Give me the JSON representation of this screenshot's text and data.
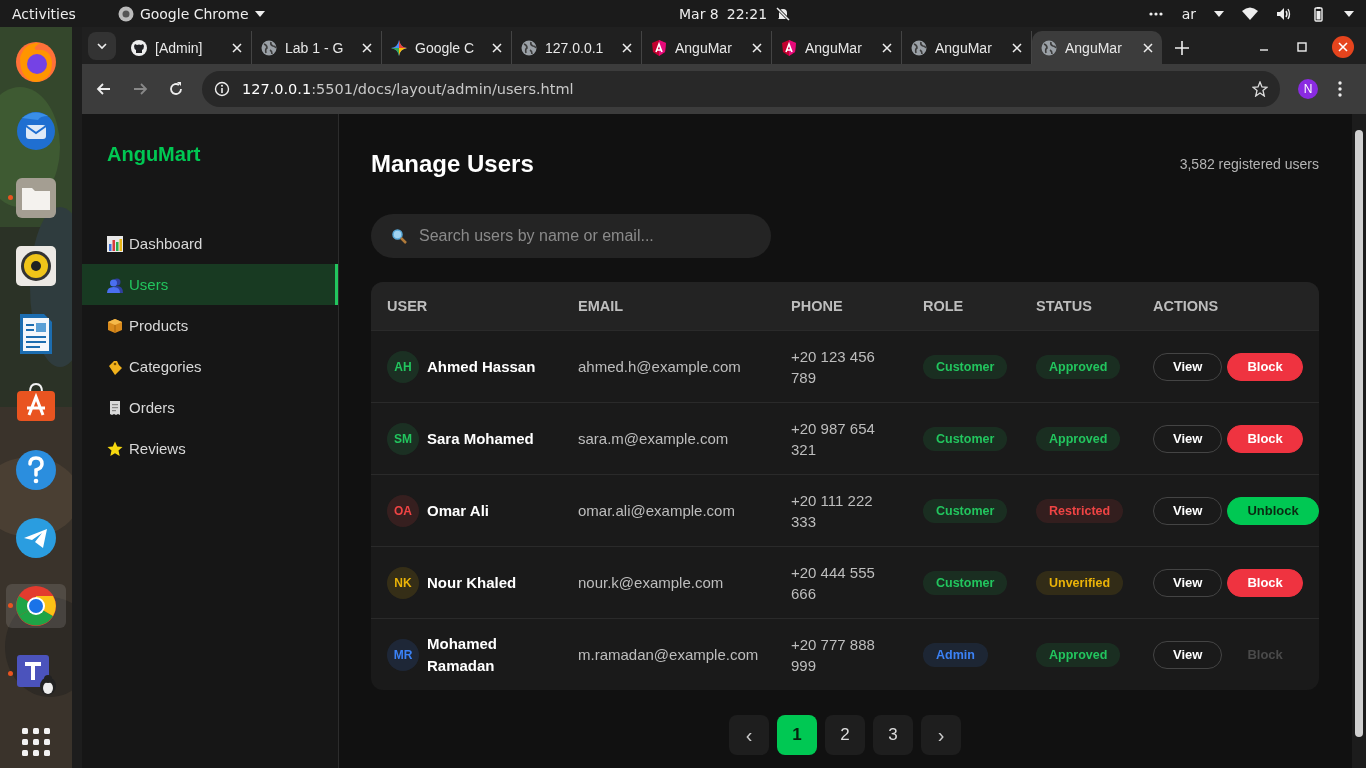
{
  "topbar": {
    "activities": "Activities",
    "app_name": "Google Chrome",
    "date": "Mar 8",
    "time": "22:21",
    "input_source": "ar"
  },
  "dock": [
    {
      "kind": "firefox",
      "running": false
    },
    {
      "kind": "thunderbird",
      "running": false
    },
    {
      "kind": "files",
      "running": true
    },
    {
      "kind": "rhythmbox",
      "running": false
    },
    {
      "kind": "writer",
      "running": false
    },
    {
      "kind": "software",
      "running": false
    },
    {
      "kind": "help",
      "running": false
    },
    {
      "kind": "telegram",
      "running": false
    },
    {
      "kind": "chrome",
      "running": true
    },
    {
      "kind": "teams",
      "running": true
    },
    {
      "kind": "apps",
      "running": false
    }
  ],
  "browser": {
    "tabs": [
      {
        "title": "[Admin]",
        "kind": "github",
        "selected": false
      },
      {
        "title": "Lab 1 - G",
        "kind": "globe",
        "selected": false
      },
      {
        "title": "Google C",
        "kind": "gemini",
        "selected": false
      },
      {
        "title": "127.0.0.1",
        "kind": "globe",
        "selected": false
      },
      {
        "title": "AnguMar",
        "kind": "angular",
        "selected": false
      },
      {
        "title": "AnguMar",
        "kind": "angular",
        "selected": false
      },
      {
        "title": "AnguMar",
        "kind": "globe",
        "selected": false
      },
      {
        "title": "AnguMar",
        "kind": "globe",
        "selected": true
      }
    ],
    "url_host": "127.0.0.1",
    "url_path": ":5501/docs/layout/admin/users.html",
    "profile": "N"
  },
  "app": {
    "brand": "AnguMart",
    "nav": [
      {
        "label": "Dashboard",
        "kind": "chart",
        "selected": false
      },
      {
        "label": "Users",
        "kind": "users",
        "selected": true
      },
      {
        "label": "Products",
        "kind": "box",
        "selected": false
      },
      {
        "label": "Categories",
        "kind": "tag",
        "selected": false
      },
      {
        "label": "Orders",
        "kind": "receipt",
        "selected": false
      },
      {
        "label": "Reviews",
        "kind": "star",
        "selected": false
      }
    ],
    "title": "Manage Users",
    "count": "3,582 registered users",
    "search": {
      "placeholder": "Search users by name or email..."
    },
    "table": {
      "columns": [
        "USER",
        "EMAIL",
        "PHONE",
        "ROLE",
        "STATUS",
        "ACTIONS"
      ],
      "rows": [
        {
          "initials": "AH",
          "name": "Ahmed Hassan",
          "email": "ahmed.h@example.com",
          "phone": "+20 123 456 789",
          "role": {
            "label": "Customer",
            "kind": "customer"
          },
          "status": {
            "label": "Approved",
            "kind": "approved"
          },
          "view": "View",
          "action": {
            "label": "Block",
            "kind": "block",
            "disabled": false
          }
        },
        {
          "initials": "SM",
          "name": "Sara Mohamed",
          "email": "sara.m@example.com",
          "phone": "+20 987 654 321",
          "role": {
            "label": "Customer",
            "kind": "customer"
          },
          "status": {
            "label": "Approved",
            "kind": "approved"
          },
          "view": "View",
          "action": {
            "label": "Block",
            "kind": "block",
            "disabled": false
          }
        },
        {
          "initials": "OA",
          "name": "Omar Ali",
          "email": "omar.ali@example.com",
          "phone": "+20 111 222 333",
          "role": {
            "label": "Customer",
            "kind": "customer"
          },
          "status": {
            "label": "Restricted",
            "kind": "restricted"
          },
          "view": "View",
          "action": {
            "label": "Unblock",
            "kind": "unblock",
            "disabled": false
          }
        },
        {
          "initials": "NK",
          "name": "Nour Khaled",
          "email": "nour.k@example.com",
          "phone": "+20 444 555 666",
          "role": {
            "label": "Customer",
            "kind": "customer"
          },
          "status": {
            "label": "Unverified",
            "kind": "unverified"
          },
          "view": "View",
          "action": {
            "label": "Block",
            "kind": "block",
            "disabled": false
          }
        },
        {
          "initials": "MR",
          "name": "Mohamed Ramadan",
          "email": "m.ramadan@example.com",
          "phone": "+20 777 888 999",
          "role": {
            "label": "Admin",
            "kind": "admin"
          },
          "status": {
            "label": "Approved",
            "kind": "approved"
          },
          "view": "View",
          "action": {
            "label": "Block",
            "kind": "block",
            "disabled": true
          }
        }
      ]
    },
    "pagination": [
      {
        "label": "‹",
        "kind": "prev",
        "selected": false
      },
      {
        "label": "1",
        "kind": "page",
        "selected": true
      },
      {
        "label": "2",
        "kind": "page",
        "selected": false
      },
      {
        "label": "3",
        "kind": "page",
        "selected": false
      },
      {
        "label": "›",
        "kind": "next",
        "selected": false
      }
    ]
  }
}
